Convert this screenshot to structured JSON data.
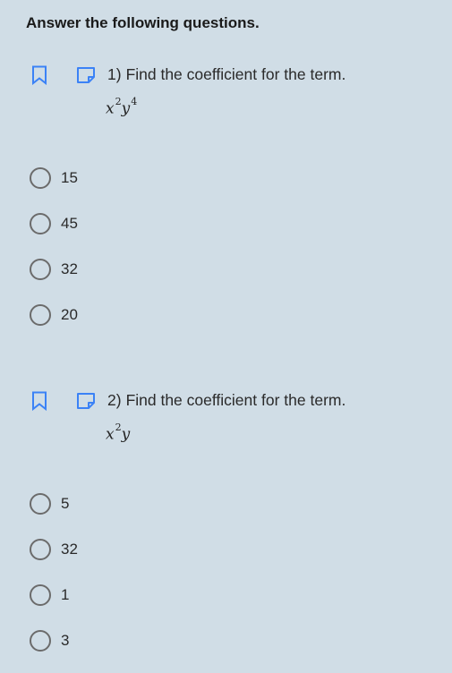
{
  "header": {
    "title": "Answer the following questions."
  },
  "questions": [
    {
      "number": "1)",
      "text": "Find the coefficient for the term.",
      "term": {
        "base1": "x",
        "exp1": "2",
        "base2": "y",
        "exp2": "4"
      },
      "options": [
        "15",
        "45",
        "32",
        "20"
      ]
    },
    {
      "number": "2)",
      "text": "Find the coefficient for the term.",
      "term": {
        "base1": "x",
        "exp1": "2",
        "base2": "y",
        "exp2": ""
      },
      "options": [
        "5",
        "32",
        "1",
        "3"
      ]
    }
  ],
  "colors": {
    "background": "#d0dde6",
    "bookmark_icon": "#3b82f6",
    "note_icon": "#3b82f6",
    "radio_border": "#6b6b6b"
  },
  "icons": {
    "bookmark": "bookmark-icon",
    "note": "note-icon"
  }
}
